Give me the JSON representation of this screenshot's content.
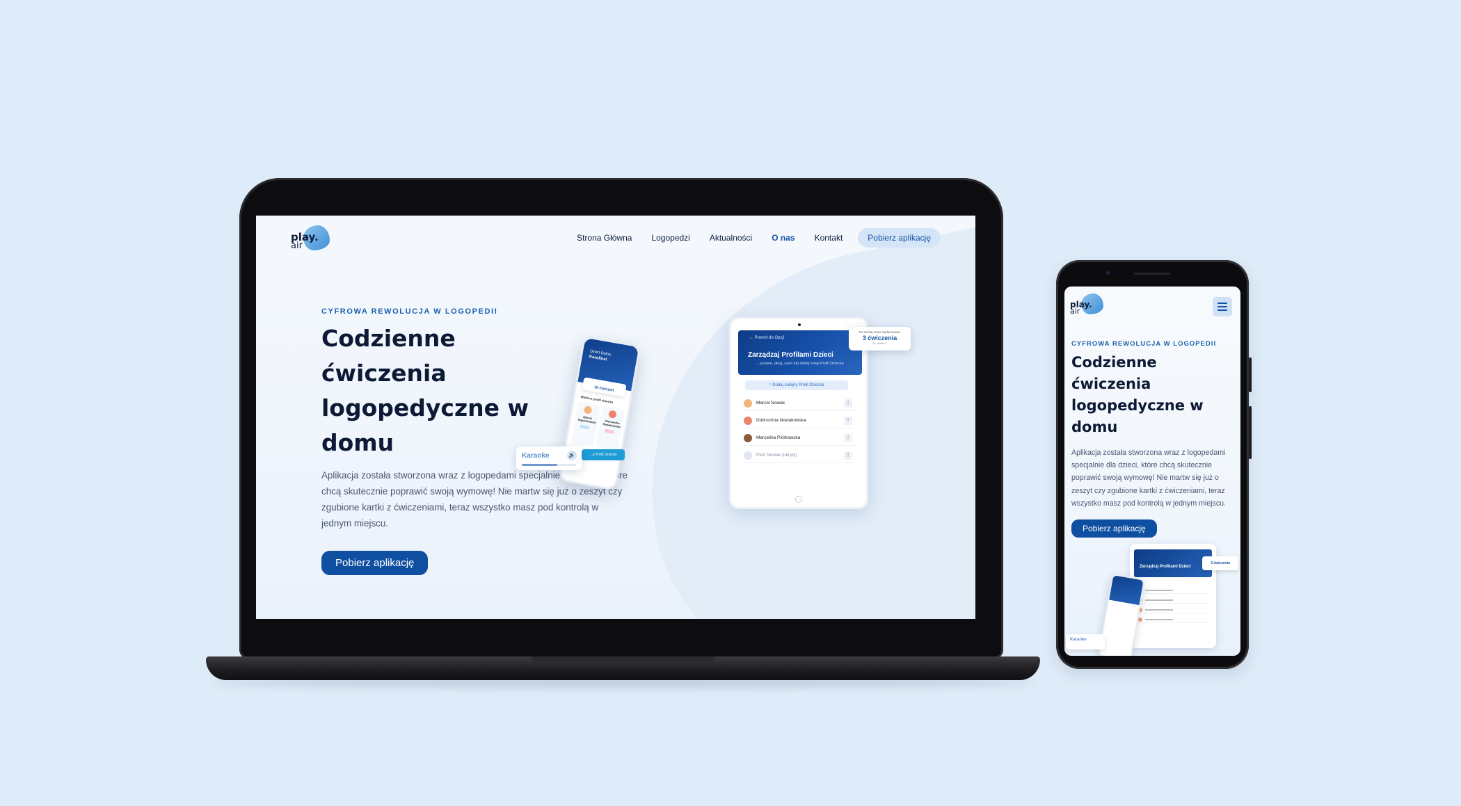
{
  "brand": {
    "logo_main": "play.",
    "logo_sub": "air"
  },
  "nav": {
    "items": [
      "Strona Główna",
      "Logopedzi",
      "Aktualności",
      "O nas",
      "Kontakt"
    ],
    "active": "O nas",
    "cta": "Pobierz aplikację"
  },
  "hero": {
    "eyebrow": "CYFROWA REWOLUCJA W LOGOPEDII",
    "title_line1": "Codzienne ćwiczenia",
    "title_line2": "logopedyczne w domu",
    "description": "Aplikacja została stworzona wraz z logopedami specjalnie dla dzieci, które chcą skutecznie poprawić swoją wymowę! Nie martw się już o zeszyt czy zgubione kartki z ćwiczeniami, teraz wszystko masz pod kontrolą w jednym miejscu.",
    "cta": "Pobierz aplikację"
  },
  "tablet_mockup": {
    "back": "Powrót do Opcji",
    "title": "Zarządzaj Profilami Dzieci",
    "subtitle": "...uj dane, ukryj, usuń lub dodaj nowy Profil Dziecka",
    "add_button": "Dodaj kolejny Profil Dziecka",
    "children": [
      {
        "name": "Marcel Nowak",
        "avatar_color": "#f3b37a",
        "hidden": false
      },
      {
        "name": "Dobrochna Nowakowska",
        "avatar_color": "#e9856e",
        "hidden": false
      },
      {
        "name": "Marcelina Piórkowska",
        "avatar_color": "#8a5a3c",
        "hidden": false
      },
      {
        "name": "Piotr Nowak (ukryty)",
        "avatar_color": "#dfe6ef",
        "hidden": true
      }
    ],
    "dots": "⋮"
  },
  "float_card": {
    "top": "Na dzisiaj masz zaplanowane",
    "value": "3 ćwiczenia",
    "bottom": "Do dzieła !!"
  },
  "mini_phone": {
    "greeting": "Dzień Dobry,",
    "name": "Karolina!",
    "exercises": "10 ćwiczeń",
    "section": "Wybierz profil dziecka",
    "kids": [
      {
        "name": "Marcel Napiórkowski",
        "face_color": "#f3b37a",
        "badge_color": "#bfe4f5"
      },
      {
        "name": "Aleksandra Nowakowska",
        "face_color": "#e9856e",
        "badge_color": "#f7c7dc"
      }
    ]
  },
  "karaoke": {
    "label": "Karaoke",
    "icon": "🔊",
    "progress": 0.65,
    "tab": "...y Profil Dziecka"
  },
  "mobile": {
    "menu_icon": "hamburger-icon",
    "title_line1": "Codzienne ćwiczenia",
    "title_line2": "logopedyczne w",
    "title_line3": "domu",
    "tablet_title": "Zarządzaj Profilami Dzieci",
    "float_value": "3 ćwiczenia",
    "karaoke": "Karaoke"
  },
  "colors": {
    "background": "#deebf8",
    "primary": "#0f4fa1",
    "accent": "#1b5fae",
    "nav_cta_bg": "#d4e5f8"
  }
}
